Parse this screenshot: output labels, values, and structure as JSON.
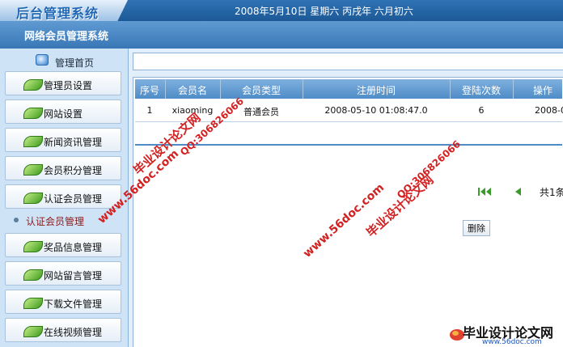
{
  "header": {
    "logo": "后台管理系统",
    "date": "2008年5月10日  星期六  丙戌年  六月初六",
    "system_title": "网络会员管理系统"
  },
  "sidebar": {
    "home": "管理首页",
    "items": [
      "管理员设置",
      "网站设置",
      "新闻资讯管理",
      "会员积分管理",
      "认证会员管理"
    ],
    "active_sub": "认证会员管理",
    "items_after": [
      "奖品信息管理",
      "网站留言管理",
      "下载文件管理",
      "在线视频管理"
    ]
  },
  "table": {
    "headers": [
      "序号",
      "会员名",
      "会员类型",
      "注册时间",
      "登陆次数",
      "操作"
    ],
    "rows": [
      [
        "1",
        "xiaoming",
        "普通会员",
        "2008-05-10 01:08:47.0",
        "6",
        "2008-0"
      ]
    ]
  },
  "pagination": {
    "total": "共1条"
  },
  "actions": {
    "delete": "删除"
  },
  "watermarks": {
    "site_name": "毕业设计论文网",
    "qq": "QQ:306826066",
    "url": "www.56doc.com"
  },
  "bottom_logo": {
    "title": "毕业设计论文网",
    "url": "www.56doc.com"
  },
  "colors": {
    "header": "#1c5896",
    "watermark": "#d42020",
    "sub_active": "#8b1a1a"
  }
}
